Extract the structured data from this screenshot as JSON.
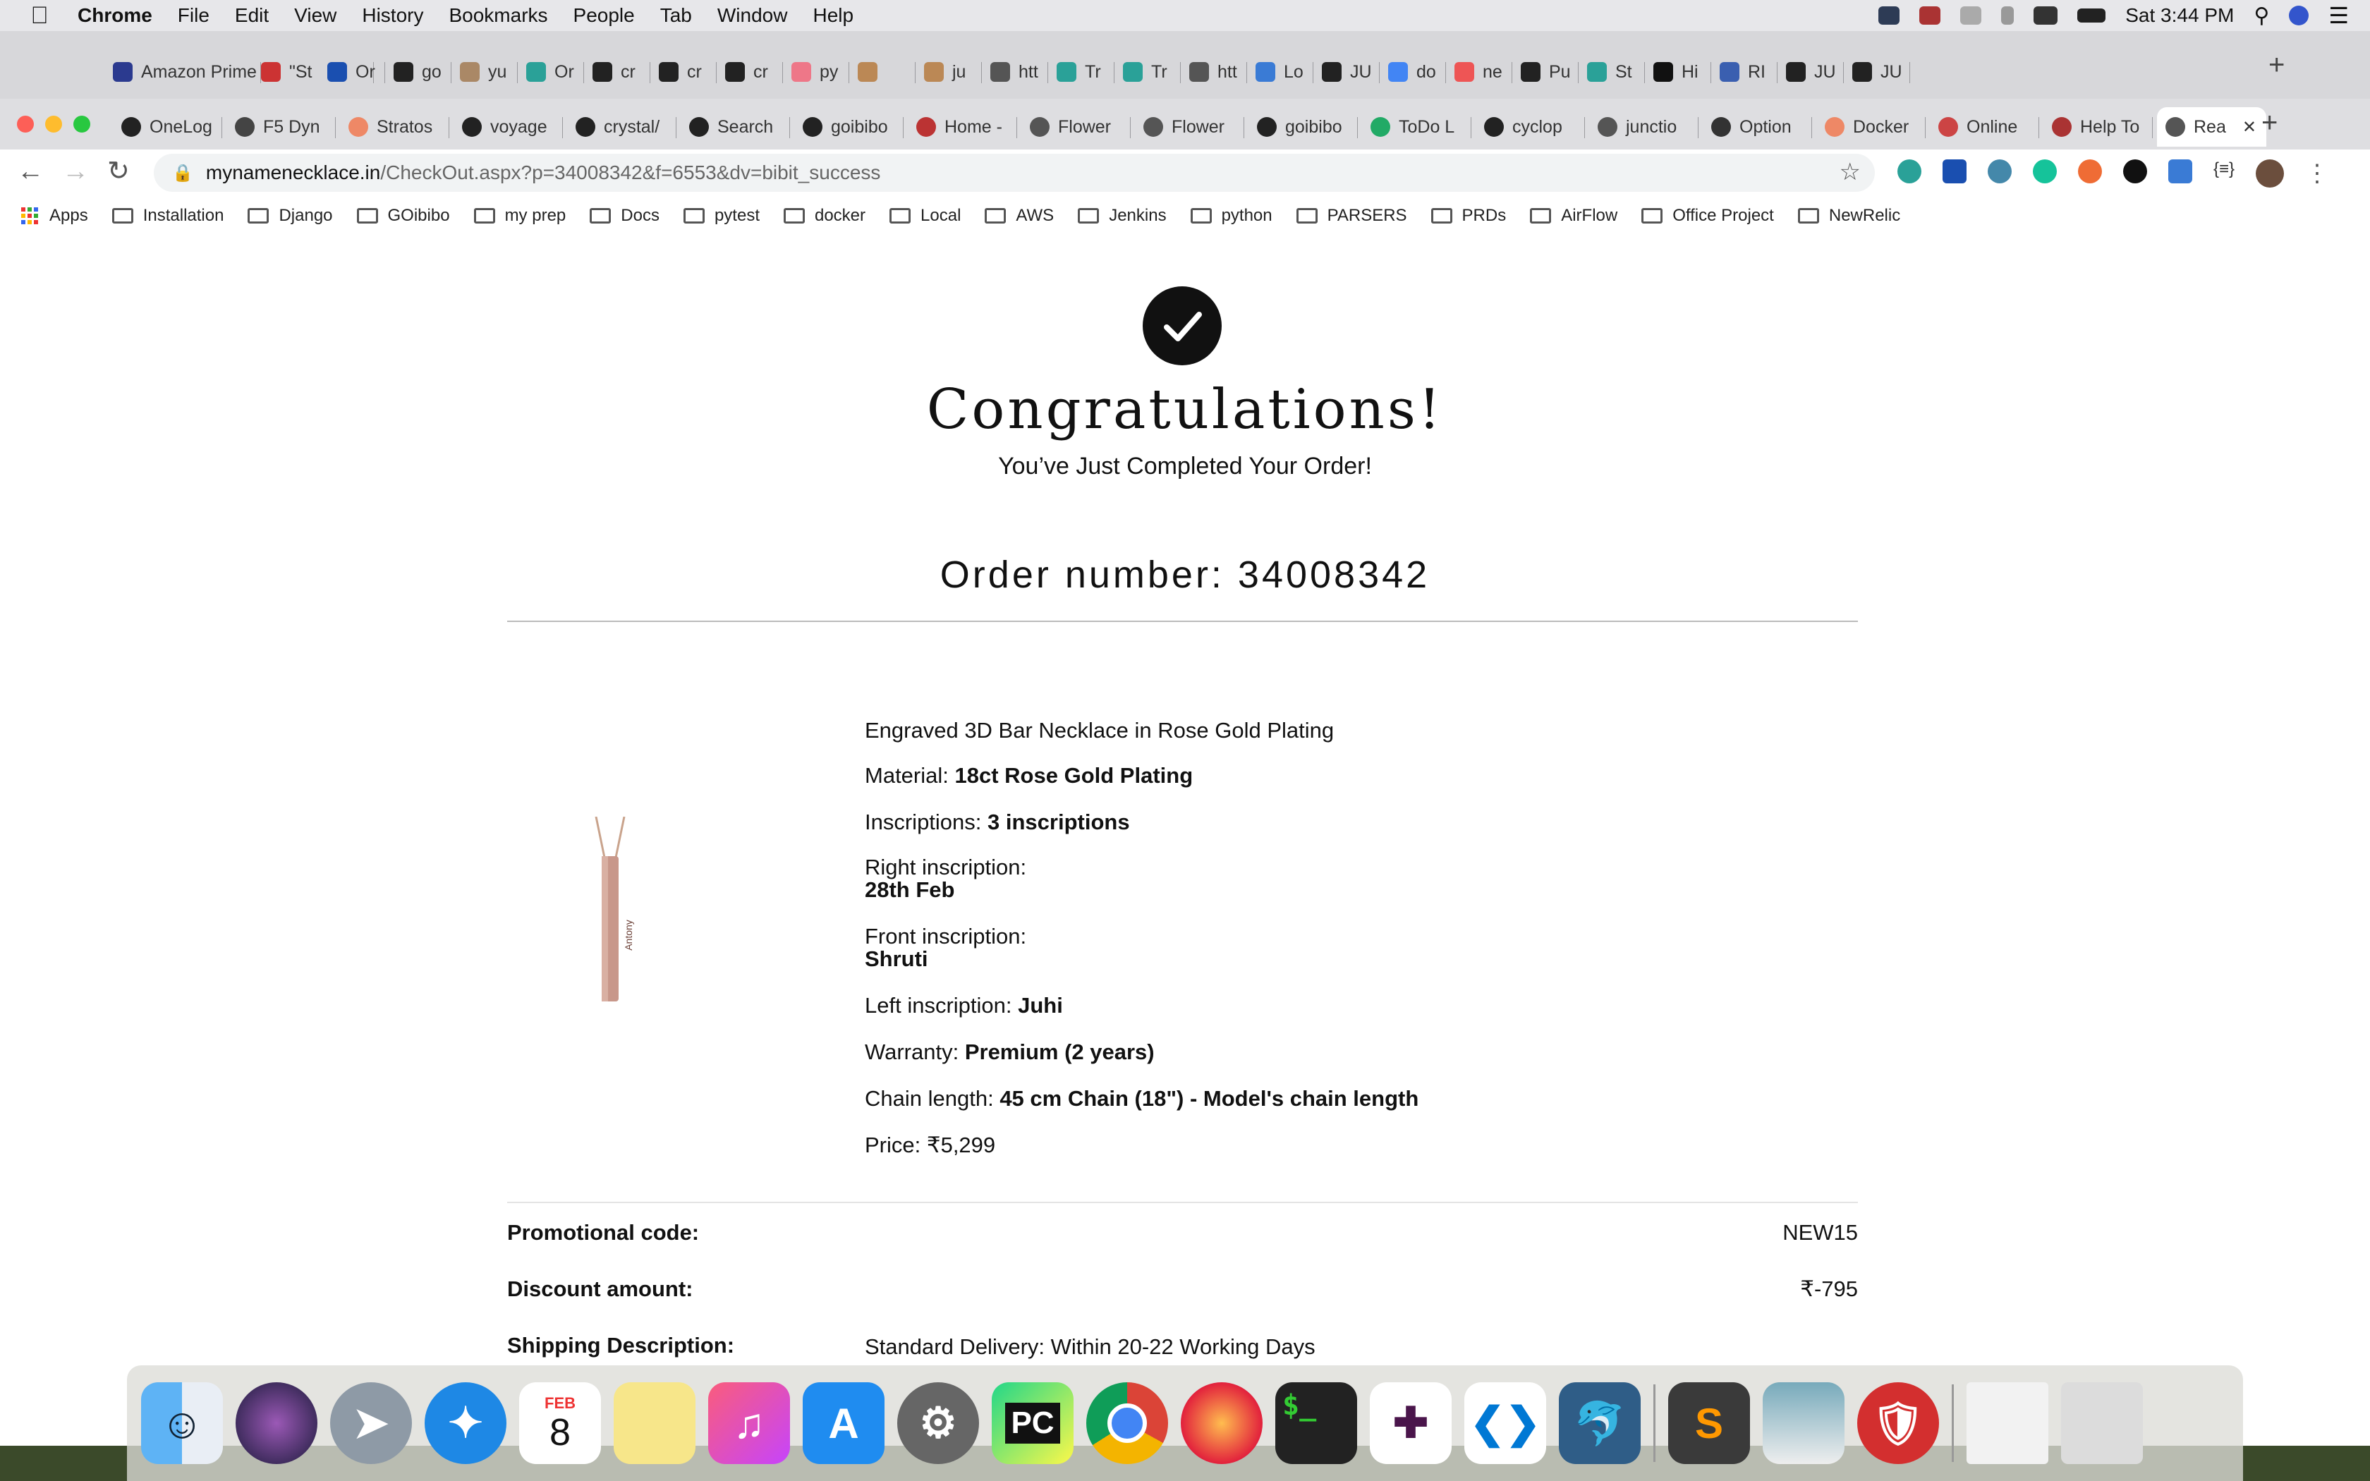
{
  "menubar": {
    "app": "Chrome",
    "items": [
      "File",
      "Edit",
      "View",
      "History",
      "Bookmarks",
      "People",
      "Tab",
      "Window",
      "Help"
    ],
    "clock": "Sat 3:44 PM"
  },
  "tabs_row1": [
    "Amazon Prime",
    "\"St",
    "Or",
    "go",
    "yu",
    "Or",
    "cr",
    "cr",
    "cr",
    "py",
    "",
    "ju",
    "htt",
    "Tr",
    "Tr",
    "htt",
    "Lo",
    "JU",
    "do",
    "ne",
    "Pu",
    "St",
    "Hi",
    "RI",
    "JU",
    "JU"
  ],
  "tabs_row2": [
    "OneLog",
    "F5 Dyn",
    "Stratos",
    "voyage",
    "crystal/",
    "Search",
    "goibibo",
    "Home -",
    "Flower",
    "Flower",
    "goibibo",
    "ToDo L",
    "cyclop",
    "junctio",
    "Option",
    "Docker",
    "Online",
    "Help To",
    "Rea"
  ],
  "address": {
    "domain": "mynamenecklace.in",
    "path": "/CheckOut.aspx?p=34008342&f=6553&dv=bibit_success"
  },
  "bookmarks": [
    "Apps",
    "Installation",
    "Django",
    "GOibibo",
    "my prep",
    "Docs",
    "pytest",
    "docker",
    "Local",
    "AWS",
    "Jenkins",
    "python",
    "PARSERS",
    "PRDs",
    "AirFlow",
    "Office Project",
    "NewRelic"
  ],
  "page": {
    "heading": "Congratulations!",
    "subheading": "You’ve Just Completed Your Order!",
    "order_number": "Order number: 34008342",
    "product": {
      "name": "Engraved 3D Bar Necklace in Rose Gold Plating",
      "material_label": "Material:",
      "material": "18ct Rose Gold Plating",
      "inscriptions_label": "Inscriptions:",
      "inscriptions": "3 inscriptions",
      "right_label": "Right inscription:",
      "right": "28th Feb",
      "front_label": "Front inscription:",
      "front": "Shruti",
      "left_label": "Left inscription:",
      "left": "Juhi",
      "warranty_label": "Warranty:",
      "warranty": "Premium (2 years)",
      "chain_label": "Chain length:",
      "chain": "45 cm Chain (18\") - Model's chain length",
      "price": "Price: ₹5,299",
      "image_engraving": "Antony"
    },
    "summary": {
      "promo_label": "Promotional code:",
      "promo_value": "NEW15",
      "discount_label": "Discount amount:",
      "discount_value": "₹-795",
      "shipping_label": "Shipping Description:",
      "shipping_value": "Standard Delivery: Within 20-22 Working Days"
    }
  },
  "dock": {
    "calendar_month": "FEB",
    "calendar_day": "8",
    "pycharm": "PC",
    "terminal": "$_"
  }
}
